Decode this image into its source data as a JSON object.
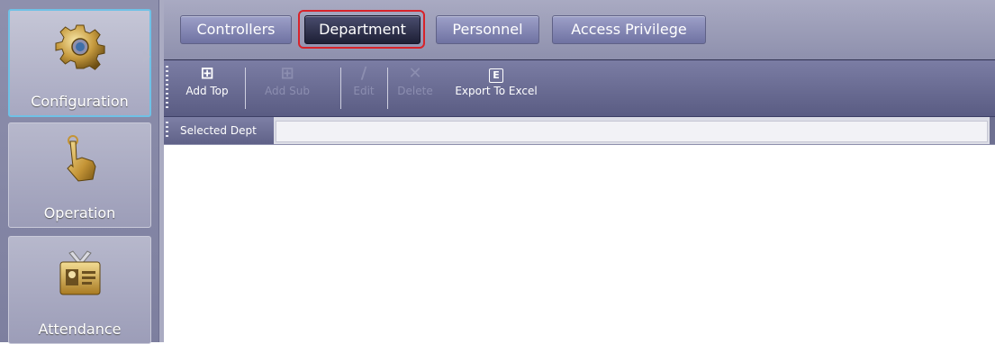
{
  "sidebar": {
    "items": [
      {
        "label": "Configuration",
        "icon": "gear-icon",
        "active": true
      },
      {
        "label": "Operation",
        "icon": "pointing-hand-icon",
        "active": false
      },
      {
        "label": "Attendance",
        "icon": "id-card-icon",
        "active": false
      }
    ]
  },
  "tabs": [
    {
      "label": "Controllers",
      "active": false
    },
    {
      "label": "Department",
      "active": true,
      "highlighted": true
    },
    {
      "label": "Personnel",
      "active": false
    },
    {
      "label": "Access Privilege",
      "active": false
    }
  ],
  "toolbar": {
    "add_top": {
      "label": "Add Top",
      "icon": "add-node-icon",
      "enabled": true
    },
    "add_sub": {
      "label": "Add Sub",
      "icon": "add-node-icon",
      "enabled": false
    },
    "edit": {
      "label": "Edit",
      "icon": "pencil-icon",
      "enabled": false
    },
    "delete": {
      "label": "Delete",
      "icon": "close-icon",
      "enabled": false
    },
    "export": {
      "label": "Export To Excel",
      "icon": "excel-icon",
      "enabled": true
    }
  },
  "selected_dept": {
    "label": "Selected Dept",
    "value": ""
  },
  "colors": {
    "highlight_border": "#d8232a",
    "active_nav_border": "#6fc1e6",
    "active_tab": "#1d1f35",
    "tab": "#6f72a2"
  }
}
